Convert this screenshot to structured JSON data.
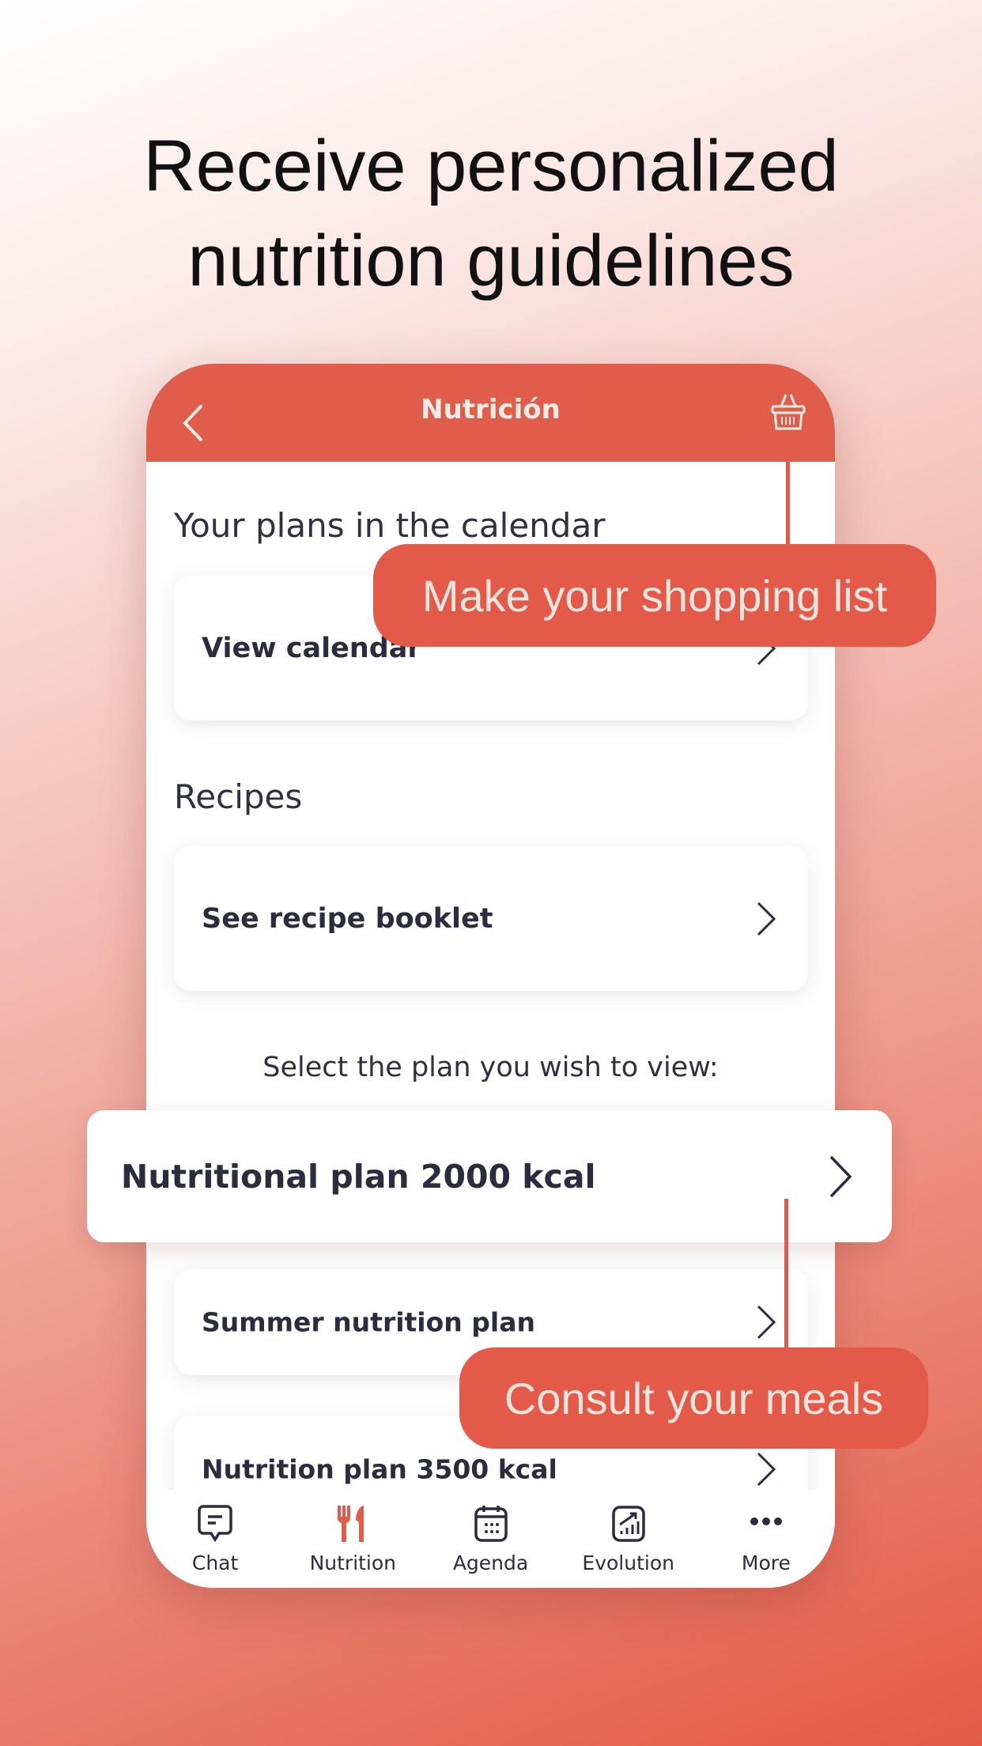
{
  "hero": {
    "line1": "Receive personalized",
    "line2": "nutrition guidelines"
  },
  "header": {
    "title": "Nutrición",
    "back_icon": "chevron-left-icon",
    "basket_icon": "shopping-basket-icon"
  },
  "sections": {
    "calendar_title": "Your plans in the calendar",
    "calendar_card": "View calendar",
    "recipes_title": "Recipes",
    "recipes_card": "See recipe booklet",
    "select_prompt": "Select the plan you wish to view:"
  },
  "plans": [
    {
      "label": "Nutritional plan 2000 kcal"
    },
    {
      "label": "Summer nutrition plan"
    },
    {
      "label": "Nutrition plan 3500 kcal"
    }
  ],
  "callouts": {
    "shopping": "Make your shopping list",
    "meals": "Consult your meals"
  },
  "nav": [
    {
      "label": "Chat",
      "icon": "chat-icon"
    },
    {
      "label": "Nutrition",
      "icon": "fork-knife-icon",
      "active": true
    },
    {
      "label": "Agenda",
      "icon": "calendar-icon"
    },
    {
      "label": "Evolution",
      "icon": "chart-growth-icon"
    },
    {
      "label": "More",
      "icon": "more-dots-icon"
    }
  ],
  "colors": {
    "accent": "#e05d4b",
    "text": "#2b2d3f"
  }
}
